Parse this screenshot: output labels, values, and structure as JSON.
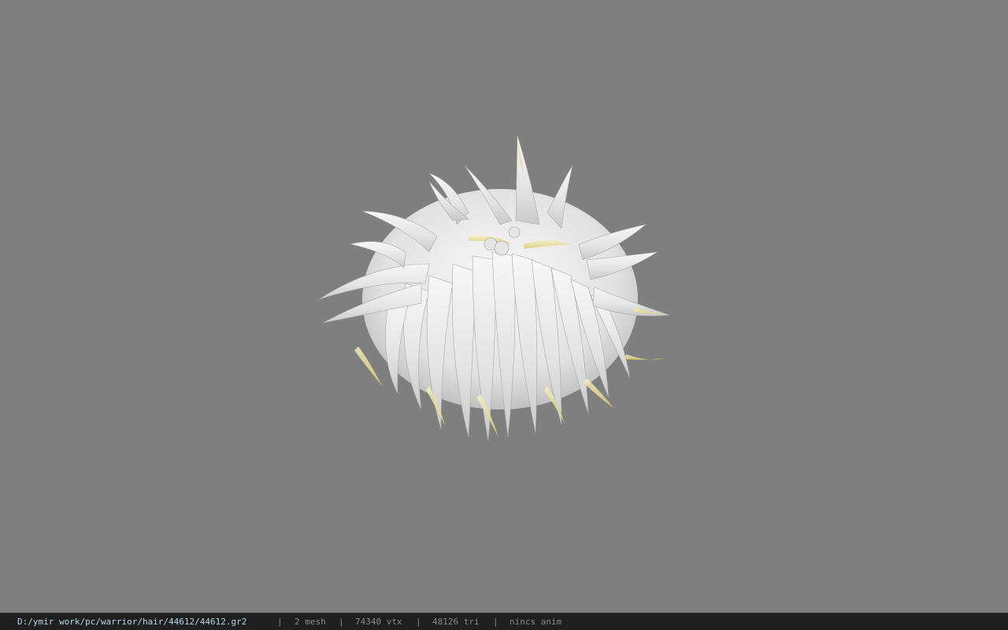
{
  "viewer": {
    "background_color": "#7f7f7f",
    "model_description": "white spiky hair mesh",
    "model_icon": "hair-mesh-render"
  },
  "status_bar": {
    "file_path": "D:/ymir work/pc/warrior/hair/44612/44612.gr2",
    "separator": "|",
    "mesh_count": "2 mesh",
    "vertex_count": "74340 vtx",
    "triangle_count": "48126 tri",
    "animation": "nincs anim"
  }
}
